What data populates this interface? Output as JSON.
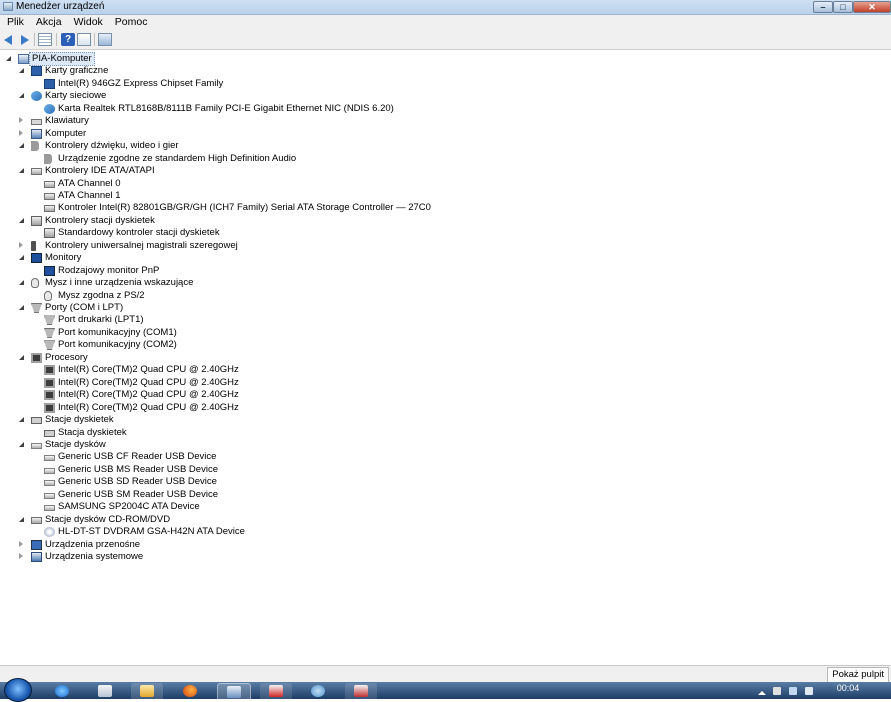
{
  "window": {
    "title": "Menedżer urządzeń",
    "buttons": {
      "minimize": "–",
      "maximize": "□",
      "close": "✕"
    }
  },
  "menu": [
    "Plik",
    "Akcja",
    "Widok",
    "Pomoc"
  ],
  "toolbar": {
    "icons": [
      "back-arrow-icon",
      "forward-arrow-icon",
      "show-hide-console-tree-icon",
      "help-icon",
      "properties-icon",
      "scan-hardware-icon"
    ],
    "help_glyph": "?"
  },
  "tree": [
    {
      "level": 0,
      "expander": "open",
      "icon": "computer-icon",
      "label": "PIA-Komputer",
      "selected": true
    },
    {
      "level": 1,
      "expander": "open",
      "icon": "display-adapter-icon",
      "label": "Karty graficzne"
    },
    {
      "level": 2,
      "expander": "none",
      "icon": "display-adapter-icon",
      "label": "Intel(R)  946GZ Express Chipset Family"
    },
    {
      "level": 1,
      "expander": "open",
      "icon": "network-adapter-icon",
      "label": "Karty sieciowe"
    },
    {
      "level": 2,
      "expander": "none",
      "icon": "network-adapter-icon",
      "label": "Karta Realtek RTL8168B/8111B Family PCI-E Gigabit Ethernet NIC (NDIS 6.20)"
    },
    {
      "level": 1,
      "expander": "closed",
      "icon": "keyboard-icon",
      "label": "Klawiatury"
    },
    {
      "level": 1,
      "expander": "closed",
      "icon": "computer-icon",
      "label": "Komputer"
    },
    {
      "level": 1,
      "expander": "open",
      "icon": "audio-icon",
      "label": "Kontrolery dźwięku, wideo i gier"
    },
    {
      "level": 2,
      "expander": "none",
      "icon": "audio-icon",
      "label": "Urządzenie zgodne ze standardem High Definition Audio"
    },
    {
      "level": 1,
      "expander": "open",
      "icon": "ide-controller-icon",
      "label": "Kontrolery IDE ATA/ATAPI"
    },
    {
      "level": 2,
      "expander": "none",
      "icon": "ide-controller-icon",
      "label": "ATA Channel 0"
    },
    {
      "level": 2,
      "expander": "none",
      "icon": "ide-controller-icon",
      "label": "ATA Channel 1"
    },
    {
      "level": 2,
      "expander": "none",
      "icon": "ide-controller-icon",
      "label": "Kontroler Intel(R) 82801GB/GR/GH (ICH7 Family) Serial ATA Storage Controller — 27C0"
    },
    {
      "level": 1,
      "expander": "open",
      "icon": "floppy-controller-icon",
      "label": "Kontrolery stacji dyskietek"
    },
    {
      "level": 2,
      "expander": "none",
      "icon": "floppy-controller-icon",
      "label": "Standardowy kontroler stacji dyskietek"
    },
    {
      "level": 1,
      "expander": "closed",
      "icon": "usb-icon",
      "label": "Kontrolery uniwersalnej magistrali szeregowej"
    },
    {
      "level": 1,
      "expander": "open",
      "icon": "monitor-icon",
      "label": "Monitory"
    },
    {
      "level": 2,
      "expander": "none",
      "icon": "monitor-icon",
      "label": "Rodzajowy monitor PnP"
    },
    {
      "level": 1,
      "expander": "open",
      "icon": "mouse-icon",
      "label": "Mysz i inne urządzenia wskazujące"
    },
    {
      "level": 2,
      "expander": "none",
      "icon": "mouse-icon",
      "label": "Mysz zgodna z PS/2"
    },
    {
      "level": 1,
      "expander": "open",
      "icon": "port-icon",
      "label": "Porty (COM i LPT)"
    },
    {
      "level": 2,
      "expander": "none",
      "icon": "port-icon",
      "label": "Port drukarki (LPT1)"
    },
    {
      "level": 2,
      "expander": "none",
      "icon": "port-icon",
      "label": "Port komunikacyjny (COM1)"
    },
    {
      "level": 2,
      "expander": "none",
      "icon": "port-icon",
      "label": "Port komunikacyjny (COM2)"
    },
    {
      "level": 1,
      "expander": "open",
      "icon": "processor-icon",
      "label": "Procesory"
    },
    {
      "level": 2,
      "expander": "none",
      "icon": "processor-icon",
      "label": "Intel(R) Core(TM)2 Quad CPU",
      "label2": "@ 2.40GHz"
    },
    {
      "level": 2,
      "expander": "none",
      "icon": "processor-icon",
      "label": "Intel(R) Core(TM)2 Quad CPU",
      "label2": "@ 2.40GHz"
    },
    {
      "level": 2,
      "expander": "none",
      "icon": "processor-icon",
      "label": "Intel(R) Core(TM)2 Quad CPU",
      "label2": "@ 2.40GHz"
    },
    {
      "level": 2,
      "expander": "none",
      "icon": "processor-icon",
      "label": "Intel(R) Core(TM)2 Quad CPU",
      "label2": "@ 2.40GHz"
    },
    {
      "level": 1,
      "expander": "open",
      "icon": "floppy-drive-icon",
      "label": "Stacje dyskietek"
    },
    {
      "level": 2,
      "expander": "none",
      "icon": "floppy-drive-icon",
      "label": "Stacja dyskietek"
    },
    {
      "level": 1,
      "expander": "open",
      "icon": "disk-drive-icon",
      "label": "Stacje dysków"
    },
    {
      "level": 2,
      "expander": "none",
      "icon": "disk-drive-icon",
      "label": "Generic USB CF Reader USB Device"
    },
    {
      "level": 2,
      "expander": "none",
      "icon": "disk-drive-icon",
      "label": "Generic USB MS Reader USB Device"
    },
    {
      "level": 2,
      "expander": "none",
      "icon": "disk-drive-icon",
      "label": "Generic USB SD Reader USB Device"
    },
    {
      "level": 2,
      "expander": "none",
      "icon": "disk-drive-icon",
      "label": "Generic USB SM Reader USB Device"
    },
    {
      "level": 2,
      "expander": "none",
      "icon": "disk-drive-icon",
      "label": "SAMSUNG SP2004C ATA Device"
    },
    {
      "level": 1,
      "expander": "open",
      "icon": "cdrom-drive-icon",
      "label": "Stacje dysków CD-ROM/DVD"
    },
    {
      "level": 2,
      "expander": "none",
      "icon": "dvd-drive-icon",
      "label": "HL-DT-ST DVDRAM GSA-H42N ATA Device"
    },
    {
      "level": 1,
      "expander": "closed",
      "icon": "portable-device-icon",
      "label": "Urządzenia przenośne"
    },
    {
      "level": 1,
      "expander": "closed",
      "icon": "system-device-icon",
      "label": "Urządzenia systemowe"
    }
  ],
  "statusbar": {
    "show_desktop": "Pokaż pulpit"
  },
  "taskbar": {
    "start": "start-orb-icon",
    "pinned": [
      "internet-explorer-icon",
      "windows-explorer-icon",
      "folder-icon",
      "firefox-icon",
      "device-manager-icon",
      "paint-icon",
      "control-panel-icon",
      "app-icon"
    ],
    "clock_time": "00:04"
  },
  "colors": {
    "selection": "#dce8f6",
    "taskbar": "#1d3d66",
    "titlebar": "#b9d1ea"
  }
}
